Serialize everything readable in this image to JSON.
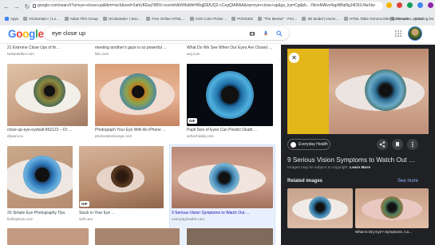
{
  "browser": {
    "url": "google.com/search?q=eye+close+up&tbm=isch&ved=2ahUKEwj7t85V-csvvinhAhWbdWrHRqjDEfUQ2-cCegQIABAA&oq=eye+close+up&gs_lcp=Cgdpb…YiiinxMAlvx4qpNBqNgJ4D53J4aXtw",
    "bookmarks": [
      "Apps",
      "OCstentain+ | Lo…",
      "Adam Film Group",
      "OCstentain+ | Boo…",
      "Free Online HTML…",
      "CSS Color Picker…",
      "PIXNUDZ",
      "\"The Mentor\" - Feri…",
      "3D Model | Horns…",
      "HTML Table Genera…",
      "Pinnacle Log On"
    ],
    "bookmarks_right": [
      "Other bookmarks",
      "Reading list"
    ]
  },
  "header": {
    "logo_letters": [
      "G",
      "o",
      "o",
      "g",
      "l",
      "e"
    ],
    "logo_colors": [
      "#4285f4",
      "#ea4335",
      "#fbbc05",
      "#4285f4",
      "#34a853",
      "#ea4335"
    ],
    "query": "eye close up"
  },
  "results": {
    "top_captions": [
      {
        "title": "21 Extreme Close Ups of th…",
        "source": "twistedsifter.com"
      },
      {
        "title": "meeting another's gaze is so powerful …",
        "source": "bbc.com"
      },
      {
        "title": "What Do We See When Our Eyes Are Closed …",
        "source": "wsj.com"
      }
    ],
    "row1": [
      {
        "title": "close-up-eye-eyeball-862122 – Dr …",
        "source": "drjoani.ca",
        "badge": ""
      },
      {
        "title": "Photograph Your Eye With An iPhone …",
        "source": "photovideolounge.com",
        "badge": ""
      },
      {
        "title": "Pupil Size of Eyes Can Predict Death …",
        "source": "achechdaily.com",
        "badge": "GIF"
      }
    ],
    "row2": [
      {
        "title": "20 Simple Eye Photography Tips",
        "source": "fixthephoto.com",
        "badge": ""
      },
      {
        "title": "Stuck in Your Eye …",
        "source": "self.com",
        "badge": "GIF"
      },
      {
        "title": "9 Serious Vision Symptoms to Watch Out …",
        "source": "everydayhealth.com",
        "badge": ""
      }
    ]
  },
  "panel": {
    "site": "Everyday Health",
    "title": "9 Serious Vision Symptoms to Watch Out …",
    "copyright_prefix": "Images may be subject to copyright.",
    "learn_more": "Learn More",
    "related_heading": "Related images",
    "see_more": "See more",
    "related": [
      {
        "caption": ""
      },
      {
        "caption": "What Is Dry Eye? Symptoms, Ca…"
      }
    ]
  },
  "colors": {
    "link": "#8ab4f8",
    "panel_bg": "#202124",
    "accent": "#4285f4"
  }
}
